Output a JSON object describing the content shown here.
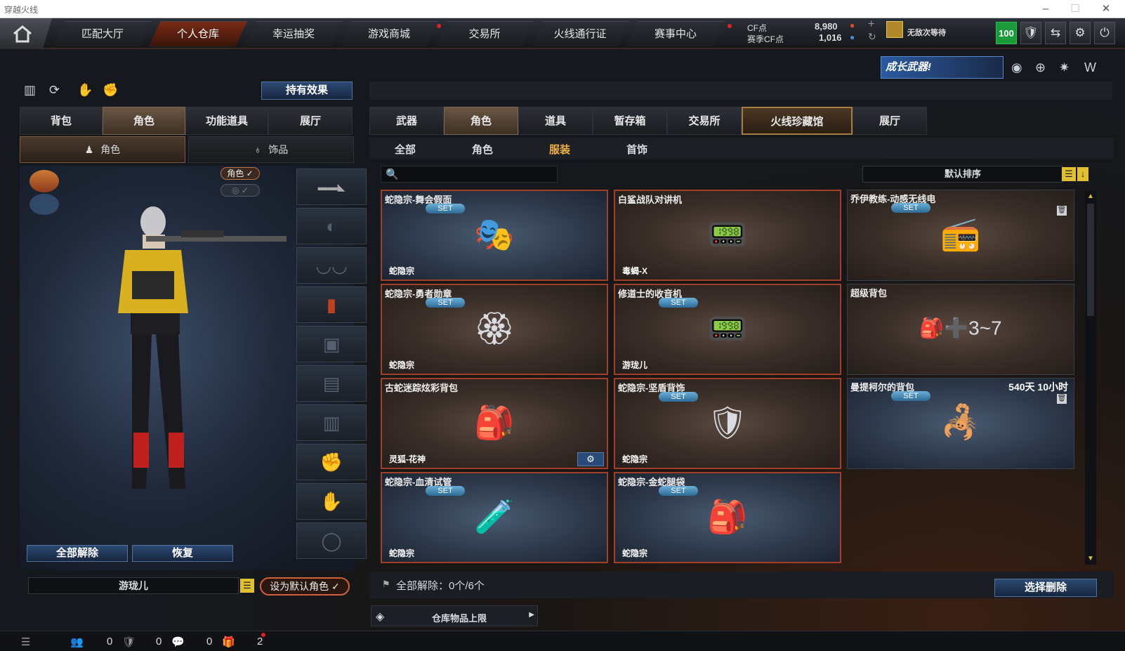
{
  "window": {
    "title": "穿越火线"
  },
  "nav": {
    "tabs": [
      "匹配大厅",
      "个人仓库",
      "幸运抽奖",
      "游戏商城",
      "交易所",
      "火线通行证",
      "赛事中心"
    ]
  },
  "currency": {
    "cf_label": "CF点",
    "cf_value": "8,980",
    "season_label": "赛季CF点",
    "season_value": "1,016",
    "rank": "无敌次等待",
    "level": "100"
  },
  "banner": {
    "text": "成长武器!"
  },
  "left": {
    "hold_effect": "持有效果",
    "tabs": [
      "背包",
      "角色",
      "功能道具",
      "展厅"
    ],
    "subtabs": [
      "角色",
      "饰品"
    ],
    "badge_role": "角色",
    "release_all": "全部解除",
    "restore": "恢复",
    "char_name": "游珑儿",
    "set_default": "设为默认角色"
  },
  "right": {
    "tabs": [
      "武器",
      "角色",
      "道具",
      "暂存箱",
      "交易所",
      "火线珍藏馆",
      "展厅"
    ],
    "subtabs": [
      "全部",
      "角色",
      "服装",
      "首饰"
    ],
    "search_placeholder": "",
    "sort": "默认排序",
    "items": [
      {
        "name": "蛇隐宗-舞会假面",
        "set": "SET",
        "owner": "蛇隐宗",
        "icon": "mask-icon",
        "glyph": "🎭"
      },
      {
        "name": "白鲨战队对讲机",
        "set": "",
        "owner": "毒蝎-X",
        "icon": "radio-icon",
        "glyph": "📟"
      },
      {
        "name": "乔伊教练-动感无线电",
        "set": "SET",
        "owner": "",
        "icon": "walkie-icon",
        "glyph": "📻"
      },
      {
        "name": "蛇隐宗-勇者勋章",
        "set": "SET",
        "owner": "蛇隐宗",
        "icon": "medal-icon",
        "glyph": "🏵"
      },
      {
        "name": "修道士的收音机",
        "set": "SET",
        "owner": "游珑儿",
        "icon": "radio-icon",
        "glyph": "📟"
      },
      {
        "name": "超级背包",
        "set": "",
        "owner": "",
        "icon": "backpack-icon",
        "glyph": "🎒➕3~7"
      },
      {
        "name": "古蛇迷踪炫彩背包",
        "set": "",
        "owner": "灵狐-花神",
        "icon": "backpack-icon",
        "glyph": "🎒"
      },
      {
        "name": "蛇隐宗-坚盾背饰",
        "set": "SET",
        "owner": "蛇隐宗",
        "icon": "shield-icon",
        "glyph": "🛡"
      },
      {
        "name": "曼提柯尔的背包",
        "set": "SET",
        "owner": "",
        "time": "540天 10小时",
        "icon": "backpack-icon",
        "glyph": "🦂"
      },
      {
        "name": "蛇隐宗-血清试管",
        "set": "SET",
        "owner": "蛇隐宗",
        "icon": "tube-icon",
        "glyph": "🧪"
      },
      {
        "name": "蛇隐宗-金蛇腿袋",
        "set": "SET",
        "owner": "蛇隐宗",
        "icon": "pouch-icon",
        "glyph": "🎒"
      }
    ],
    "release_summary": "全部解除：0个/6个",
    "select_delete": "选择删除",
    "storage_limit": "仓库物品上限"
  },
  "status": {
    "c1": "0",
    "c2": "0",
    "c3": "0",
    "c4": "2"
  }
}
